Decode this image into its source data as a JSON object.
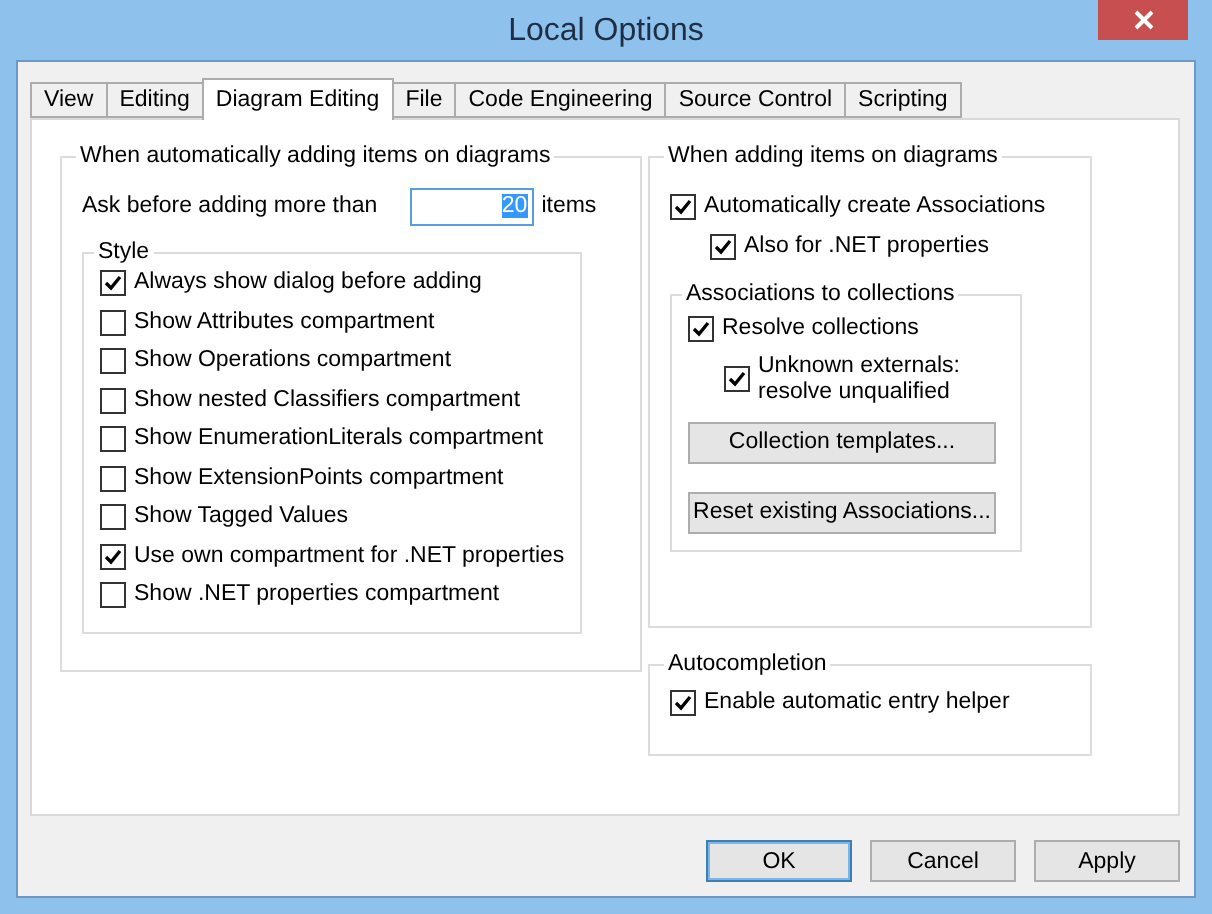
{
  "window": {
    "title": "Local Options"
  },
  "tabs": [
    {
      "label": "View",
      "selected": false
    },
    {
      "label": "Editing",
      "selected": false
    },
    {
      "label": "Diagram Editing",
      "selected": true
    },
    {
      "label": "File",
      "selected": false
    },
    {
      "label": "Code Engineering",
      "selected": false
    },
    {
      "label": "Source Control",
      "selected": false
    },
    {
      "label": "Scripting",
      "selected": false
    }
  ],
  "adding_group": {
    "title": "When automatically adding items on diagrams",
    "ask_label": "Ask before adding more than",
    "ask_value": "20",
    "ask_value_selected": true,
    "ask_suffix": "items",
    "style_group": {
      "title": "Style",
      "options": [
        {
          "label": "Always show dialog before adding",
          "checked": true
        },
        {
          "label": "Show Attributes compartment",
          "checked": false
        },
        {
          "label": "Show Operations compartment",
          "checked": false
        },
        {
          "label": "Show nested Classifiers compartment",
          "checked": false
        },
        {
          "label": "Show EnumerationLiterals compartment",
          "checked": false
        },
        {
          "label": "Show ExtensionPoints compartment",
          "checked": false
        },
        {
          "label": "Show Tagged Values",
          "checked": false
        },
        {
          "label": "Use own compartment for .NET properties",
          "checked": true
        },
        {
          "label": "Show .NET properties compartment",
          "checked": false
        }
      ]
    }
  },
  "diagram_group": {
    "title": "When adding items on diagrams",
    "create_associations": {
      "label": "Automatically create Associations",
      "checked": true
    },
    "net_properties": {
      "label": "Also for .NET properties",
      "checked": true
    },
    "collections_group": {
      "title": "Associations to collections",
      "resolve": {
        "label": "Resolve collections",
        "checked": true
      },
      "unknown_externals": {
        "label": "Unknown externals:\nresolve unqualified",
        "checked": true
      },
      "buttons": [
        "Collection templates...",
        "Reset existing Associations..."
      ]
    }
  },
  "autocompletion_group": {
    "title": "Autocompletion",
    "option": {
      "label": "Enable automatic entry helper",
      "checked": true
    }
  },
  "buttons": [
    {
      "label": "OK",
      "focused": true
    },
    {
      "label": "Cancel",
      "focused": false
    },
    {
      "label": "Apply",
      "focused": false
    }
  ]
}
